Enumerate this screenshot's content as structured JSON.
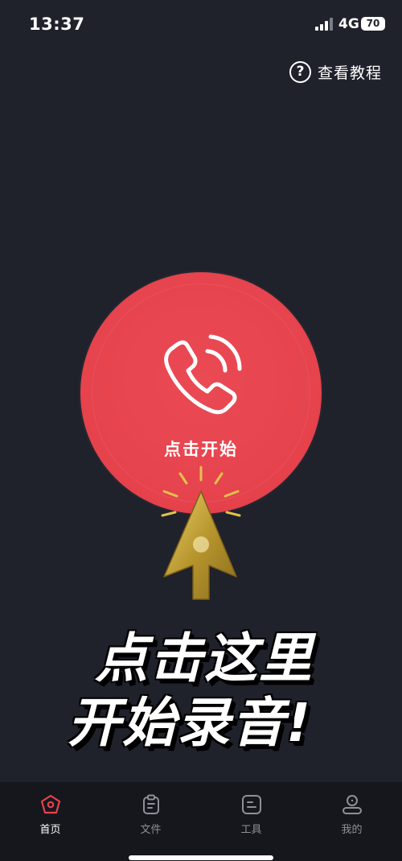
{
  "status_bar": {
    "time": "13:37",
    "network": "4G",
    "battery": "70"
  },
  "header": {
    "tutorial_label": "查看教程",
    "help_icon_glyph": "?"
  },
  "record": {
    "label": "点击开始",
    "color": "#e6434d"
  },
  "hint": {
    "line1": "点击这里",
    "line2": "开始录音!"
  },
  "tabs": [
    {
      "label": "首页",
      "icon": "home-icon",
      "active": true
    },
    {
      "label": "文件",
      "icon": "file-icon",
      "active": false
    },
    {
      "label": "工具",
      "icon": "tools-icon",
      "active": false
    },
    {
      "label": "我的",
      "icon": "profile-icon",
      "active": false
    }
  ],
  "colors": {
    "background": "#1f212b",
    "accent": "#e6434d",
    "arrow_gold": "#c9a93a"
  }
}
